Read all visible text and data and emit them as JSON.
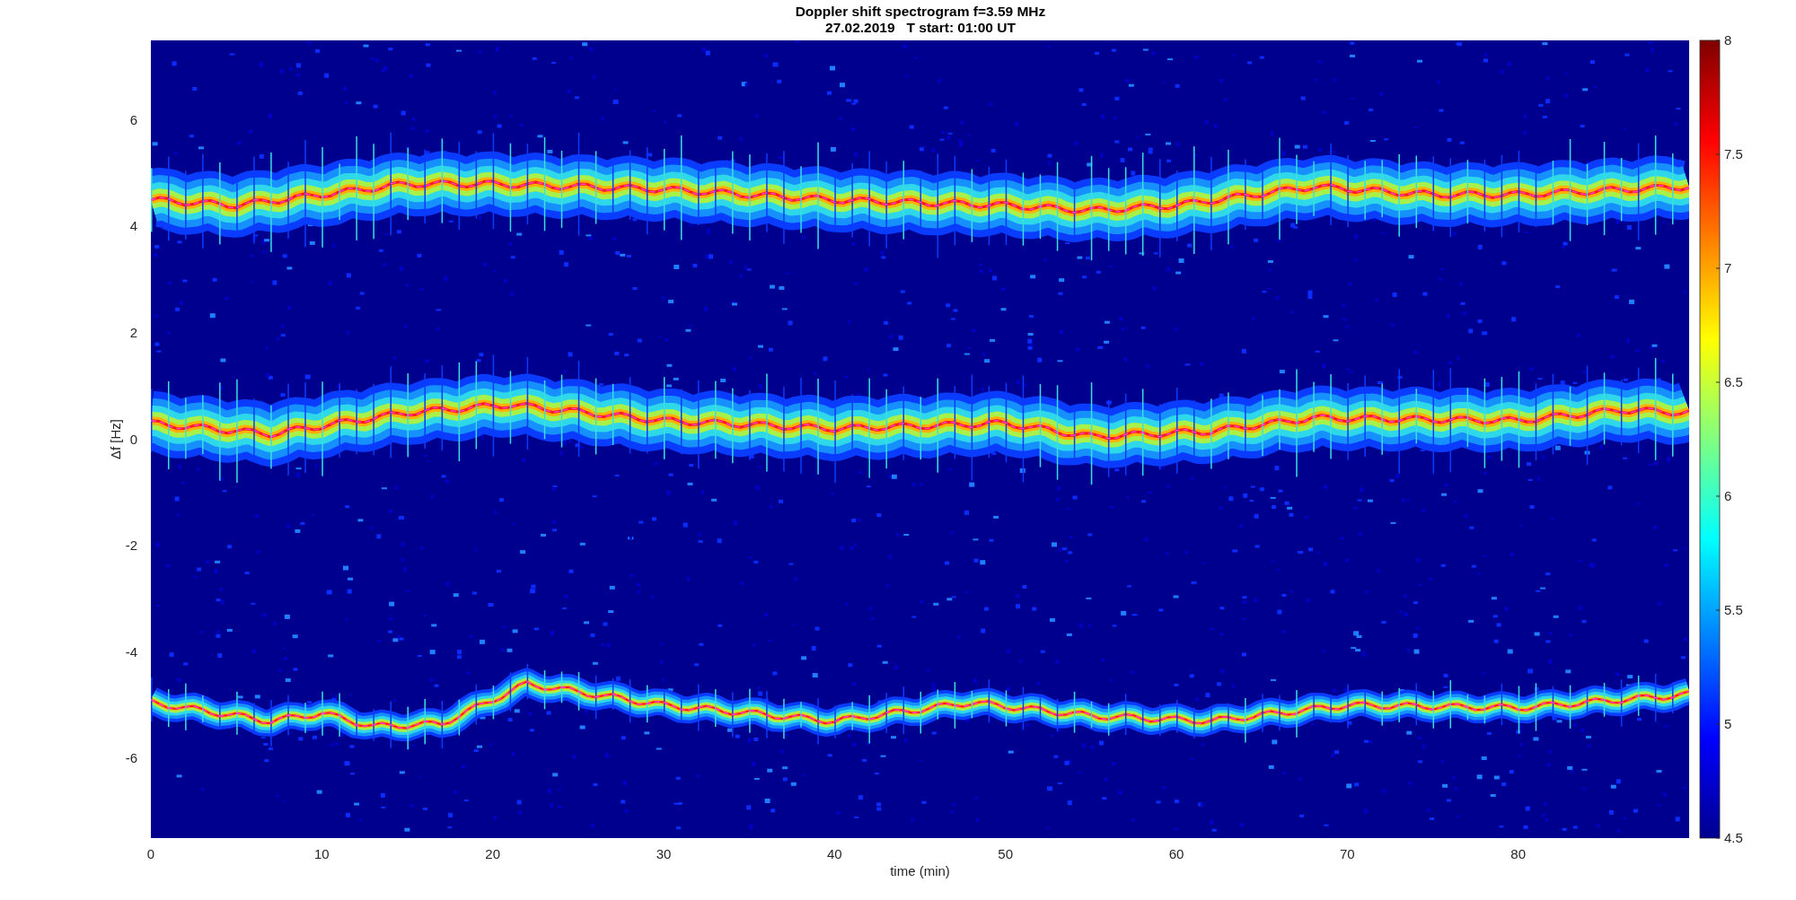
{
  "figure": {
    "title_lines": [
      "Doppler shift spectrogram f=3.59 MHz",
      "27.02.2019   T start: 01:00 UT"
    ],
    "xlabel": "time (min)",
    "ylabel": "Δf [Hz]",
    "x_ticks": [
      "0",
      "10",
      "20",
      "30",
      "40",
      "50",
      "60",
      "70",
      "80"
    ],
    "y_ticks": [
      "6",
      "4",
      "2",
      "0",
      "-2",
      "-4",
      "-6"
    ],
    "colorbar_ticks": [
      "8",
      "7.5",
      "7",
      "6.5",
      "6",
      "5.5",
      "5",
      "4.5"
    ]
  }
}
